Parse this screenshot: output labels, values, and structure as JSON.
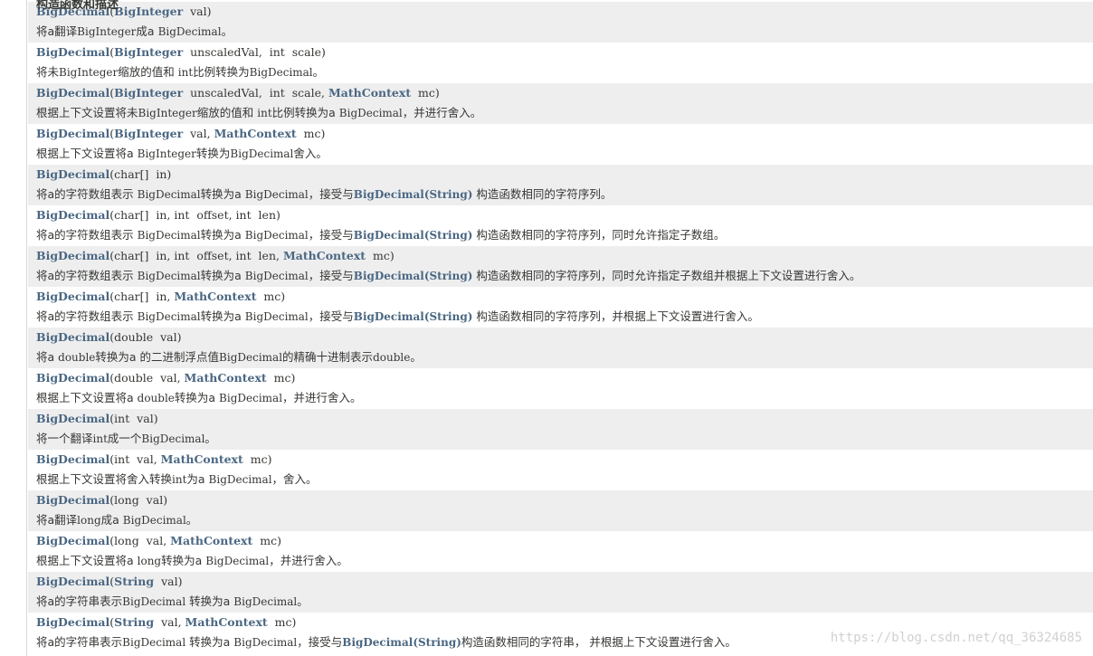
{
  "section_header": "构造函数和描述",
  "watermark": "https://blog.csdn.net/qq_36324685",
  "rows": [
    {
      "sig": [
        [
          "cls",
          "BigDecimal"
        ],
        [
          "t",
          "("
        ],
        [
          "cls",
          "BigInteger"
        ],
        [
          "t",
          "  val)"
        ]
      ],
      "desc": [
        [
          "t",
          "将a翻译"
        ],
        [
          "code",
          "BigInteger"
        ],
        [
          "t",
          "成a "
        ],
        [
          "code",
          "BigDecimal"
        ],
        [
          "t",
          "。"
        ]
      ]
    },
    {
      "sig": [
        [
          "cls",
          "BigDecimal"
        ],
        [
          "t",
          "("
        ],
        [
          "cls",
          "BigInteger"
        ],
        [
          "t",
          "  unscaledVal,  int  scale)"
        ]
      ],
      "desc": [
        [
          "t",
          "将未"
        ],
        [
          "code",
          "BigInteger"
        ],
        [
          "t",
          "缩放的值和 "
        ],
        [
          "code",
          "int"
        ],
        [
          "t",
          "比例转换为"
        ],
        [
          "code",
          "BigDecimal"
        ],
        [
          "t",
          "。"
        ]
      ]
    },
    {
      "sig": [
        [
          "cls",
          "BigDecimal"
        ],
        [
          "t",
          "("
        ],
        [
          "cls",
          "BigInteger"
        ],
        [
          "t",
          "  unscaledVal,  int  scale, "
        ],
        [
          "cls",
          "MathContext"
        ],
        [
          "t",
          "  mc)"
        ]
      ],
      "desc": [
        [
          "t",
          "根据上下文设置将未"
        ],
        [
          "code",
          "BigInteger"
        ],
        [
          "t",
          "缩放的值和 "
        ],
        [
          "code",
          "int"
        ],
        [
          "t",
          "比例转换为a "
        ],
        [
          "code",
          "BigDecimal"
        ],
        [
          "t",
          "，并进行舍入。"
        ]
      ]
    },
    {
      "sig": [
        [
          "cls",
          "BigDecimal"
        ],
        [
          "t",
          "("
        ],
        [
          "cls",
          "BigInteger"
        ],
        [
          "t",
          "  val, "
        ],
        [
          "cls",
          "MathContext"
        ],
        [
          "t",
          "  mc)"
        ]
      ],
      "desc": [
        [
          "t",
          "根据上下文设置将a "
        ],
        [
          "code",
          "BigInteger"
        ],
        [
          "t",
          "转换为"
        ],
        [
          "code",
          "BigDecimal"
        ],
        [
          "t",
          "舍入。"
        ]
      ]
    },
    {
      "sig": [
        [
          "cls",
          "BigDecimal"
        ],
        [
          "t",
          "(char[]  in)"
        ]
      ],
      "desc": [
        [
          "t",
          "将a的字符数组表示 "
        ],
        [
          "code",
          "BigDecimal"
        ],
        [
          "t",
          "转换为a "
        ],
        [
          "code",
          "BigDecimal"
        ],
        [
          "t",
          "，接受与"
        ],
        [
          "link",
          "BigDecimal(String)"
        ],
        [
          "t",
          " 构造函数相同的字符序列。"
        ]
      ]
    },
    {
      "sig": [
        [
          "cls",
          "BigDecimal"
        ],
        [
          "t",
          "(char[]  in, int  offset, int  len)"
        ]
      ],
      "desc": [
        [
          "t",
          "将a的字符数组表示 "
        ],
        [
          "code",
          "BigDecimal"
        ],
        [
          "t",
          "转换为a "
        ],
        [
          "code",
          "BigDecimal"
        ],
        [
          "t",
          "，接受与"
        ],
        [
          "link",
          "BigDecimal(String)"
        ],
        [
          "t",
          " 构造函数相同的字符序列，同时允许指定子数组。"
        ]
      ]
    },
    {
      "sig": [
        [
          "cls",
          "BigDecimal"
        ],
        [
          "t",
          "(char[]  in, int  offset, int  len, "
        ],
        [
          "cls",
          "MathContext"
        ],
        [
          "t",
          "  mc)"
        ]
      ],
      "desc": [
        [
          "t",
          "将a的字符数组表示 "
        ],
        [
          "code",
          "BigDecimal"
        ],
        [
          "t",
          "转换为a "
        ],
        [
          "code",
          "BigDecimal"
        ],
        [
          "t",
          "，接受与"
        ],
        [
          "link",
          "BigDecimal(String)"
        ],
        [
          "t",
          " 构造函数相同的字符序列，同时允许指定子数组并根据上下文设置进行舍入。"
        ]
      ]
    },
    {
      "sig": [
        [
          "cls",
          "BigDecimal"
        ],
        [
          "t",
          "(char[]  in, "
        ],
        [
          "cls",
          "MathContext"
        ],
        [
          "t",
          "  mc)"
        ]
      ],
      "desc": [
        [
          "t",
          "将a的字符数组表示 "
        ],
        [
          "code",
          "BigDecimal"
        ],
        [
          "t",
          "转换为a "
        ],
        [
          "code",
          "BigDecimal"
        ],
        [
          "t",
          "，接受与"
        ],
        [
          "link",
          "BigDecimal(String)"
        ],
        [
          "t",
          " 构造函数相同的字符序列，并根据上下文设置进行舍入。"
        ]
      ]
    },
    {
      "sig": [
        [
          "cls",
          "BigDecimal"
        ],
        [
          "t",
          "(double  val)"
        ]
      ],
      "desc": [
        [
          "t",
          "将a "
        ],
        [
          "code",
          "double"
        ],
        [
          "t",
          "转换为a 的二进制浮点值"
        ],
        [
          "code",
          "BigDecimal"
        ],
        [
          "t",
          "的精确十进制表示"
        ],
        [
          "code",
          "double"
        ],
        [
          "t",
          "。"
        ]
      ]
    },
    {
      "sig": [
        [
          "cls",
          "BigDecimal"
        ],
        [
          "t",
          "(double  val, "
        ],
        [
          "cls",
          "MathContext"
        ],
        [
          "t",
          "  mc)"
        ]
      ],
      "desc": [
        [
          "t",
          "根据上下文设置将a "
        ],
        [
          "code",
          "double"
        ],
        [
          "t",
          "转换为a "
        ],
        [
          "code",
          "BigDecimal"
        ],
        [
          "t",
          "，并进行舍入。"
        ]
      ]
    },
    {
      "sig": [
        [
          "cls",
          "BigDecimal"
        ],
        [
          "t",
          "(int  val)"
        ]
      ],
      "desc": [
        [
          "t",
          "将一个翻译"
        ],
        [
          "code",
          "int"
        ],
        [
          "t",
          "成一个"
        ],
        [
          "code",
          "BigDecimal"
        ],
        [
          "t",
          "。"
        ]
      ]
    },
    {
      "sig": [
        [
          "cls",
          "BigDecimal"
        ],
        [
          "t",
          "(int  val, "
        ],
        [
          "cls",
          "MathContext"
        ],
        [
          "t",
          "  mc)"
        ]
      ],
      "desc": [
        [
          "t",
          "根据上下文设置将舍入转换"
        ],
        [
          "code",
          "int"
        ],
        [
          "t",
          "为a "
        ],
        [
          "code",
          "BigDecimal"
        ],
        [
          "t",
          "，舍入。"
        ]
      ]
    },
    {
      "sig": [
        [
          "cls",
          "BigDecimal"
        ],
        [
          "t",
          "(long  val)"
        ]
      ],
      "desc": [
        [
          "t",
          "将a翻译"
        ],
        [
          "code",
          "long"
        ],
        [
          "t",
          "成a "
        ],
        [
          "code",
          "BigDecimal"
        ],
        [
          "t",
          "。"
        ]
      ]
    },
    {
      "sig": [
        [
          "cls",
          "BigDecimal"
        ],
        [
          "t",
          "(long  val, "
        ],
        [
          "cls",
          "MathContext"
        ],
        [
          "t",
          "  mc)"
        ]
      ],
      "desc": [
        [
          "t",
          "根据上下文设置将a "
        ],
        [
          "code",
          "long"
        ],
        [
          "t",
          "转换为a "
        ],
        [
          "code",
          "BigDecimal"
        ],
        [
          "t",
          "，并进行舍入。"
        ]
      ]
    },
    {
      "sig": [
        [
          "cls",
          "BigDecimal"
        ],
        [
          "t",
          "("
        ],
        [
          "cls",
          "String"
        ],
        [
          "t",
          "  val)"
        ]
      ],
      "desc": [
        [
          "t",
          "将a的字符串表示"
        ],
        [
          "code",
          "BigDecimal"
        ],
        [
          "t",
          " 转换为a "
        ],
        [
          "code",
          "BigDecimal"
        ],
        [
          "t",
          "。"
        ]
      ]
    },
    {
      "sig": [
        [
          "cls",
          "BigDecimal"
        ],
        [
          "t",
          "("
        ],
        [
          "cls",
          "String"
        ],
        [
          "t",
          "  val, "
        ],
        [
          "cls",
          "MathContext"
        ],
        [
          "t",
          "  mc)"
        ]
      ],
      "desc": [
        [
          "t",
          "将a的字符串表示"
        ],
        [
          "code",
          "BigDecimal"
        ],
        [
          "t",
          " 转换为a "
        ],
        [
          "code",
          "BigDecimal"
        ],
        [
          "t",
          "，接受与"
        ],
        [
          "link",
          "BigDecimal(String)"
        ],
        [
          "t",
          "构造函数相同的字符串， 并根据上下文设置进行舍入。"
        ]
      ]
    }
  ]
}
